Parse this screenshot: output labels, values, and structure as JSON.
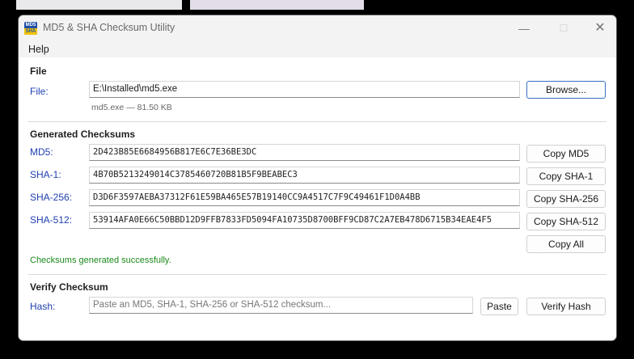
{
  "window": {
    "title": "MD5 & SHA Checksum Utility",
    "icon_text_top": "MD5",
    "icon_text_bottom": "SHA",
    "controls": {
      "minimize": "—",
      "maximize": "☐",
      "close": "✕"
    }
  },
  "menu": {
    "items": [
      {
        "label": "Help"
      }
    ]
  },
  "file_section": {
    "title": "File",
    "label": "File:",
    "path": "E:\\Installed\\md5.exe",
    "browse_label": "Browse...",
    "file_info": "md5.exe — 81.50 KB"
  },
  "checksums": {
    "title": "Generated Checksums",
    "rows": [
      {
        "label": "MD5:",
        "value": "2D423B85E6684956B817E6C7E36BE3DC",
        "button": "Copy MD5"
      },
      {
        "label": "SHA-1:",
        "value": "4B70B5213249014C3785460720B81B5F9BEABEC3",
        "button": "Copy SHA-1"
      },
      {
        "label": "SHA-256:",
        "value": "D3D6F3597AEBA37312F61E59BA465E57B19140CC9A4517C7F9C49461F1D0A4BB",
        "button": "Copy SHA-256"
      },
      {
        "label": "SHA-512:",
        "value": "53914AFA0E66C50BBD12D9FFB7833FD5094FA10735D8700BFF9CD87C2A7EB478D6715B34EAE4F5",
        "button": "Copy SHA-512"
      }
    ],
    "copy_all_label": "Copy All",
    "status": "Checksums generated successfully.",
    "status_color": "#1b8a1b"
  },
  "verify": {
    "title": "Verify Checksum",
    "label": "Hash:",
    "placeholder": "Paste an MD5, SHA-1, SHA-256 or SHA-512 checksum...",
    "paste_label": "Paste",
    "verify_label": "Verify Hash"
  },
  "colors": {
    "label_blue": "#1f3fb0",
    "accent_border": "#3a6fc4",
    "icon_blue": "#1f4fa8",
    "icon_yellow": "#f2c400"
  }
}
